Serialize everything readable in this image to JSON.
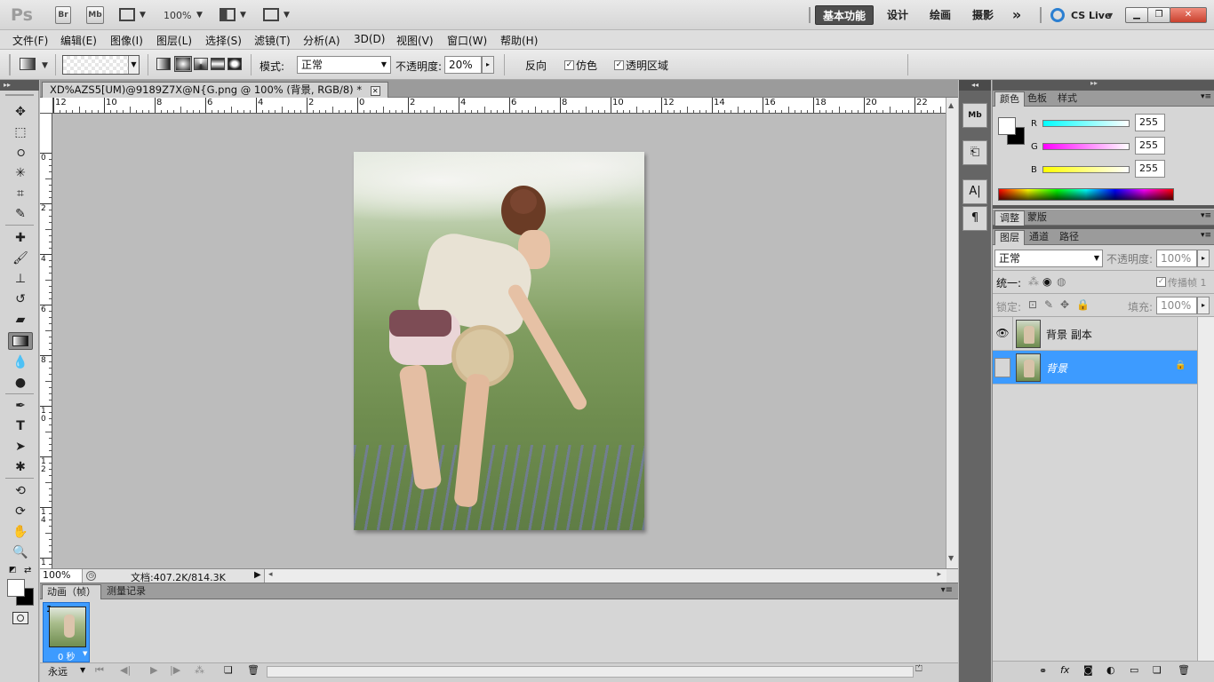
{
  "titlebar": {
    "app_logo": "Ps",
    "bridge_btn": "Br",
    "mini_bridge_btn": "Mb",
    "zoom": "100%",
    "workspaces": [
      "基本功能",
      "设计",
      "绘画",
      "摄影"
    ],
    "more": "»",
    "cs_live": "CS Live",
    "window_controls": [
      "minimize",
      "restore",
      "close"
    ]
  },
  "menu": [
    "文件(F)",
    "编辑(E)",
    "图像(I)",
    "图层(L)",
    "选择(S)",
    "滤镜(T)",
    "分析(A)",
    "3D(D)",
    "视图(V)",
    "窗口(W)",
    "帮助(H)"
  ],
  "options": {
    "mode_label": "模式:",
    "mode_value": "正常",
    "opacity_label": "不透明度:",
    "opacity_value": "20%",
    "reverse_label": "反向",
    "reverse_checked": false,
    "dither_label": "仿色",
    "dither_checked": true,
    "transparency_label": "透明区域",
    "transparency_checked": true
  },
  "document": {
    "tab_title": "XD%AZS5[UM)@9189Z7X@N{G.png @ 100% (背景, RGB/8) *",
    "ruler_h_labels": [
      "12",
      "10",
      "8",
      "6",
      "4",
      "2",
      "0",
      "2",
      "4",
      "6",
      "8",
      "10",
      "12",
      "14",
      "16",
      "18",
      "20",
      "22"
    ],
    "ruler_v_labels": [
      "0",
      "2",
      "4",
      "6",
      "8",
      "1 0",
      "1 2",
      "1 4",
      "1"
    ],
    "status_zoom": "100%",
    "status_doc": "文档:407.2K/814.3K"
  },
  "animation": {
    "tabs": [
      "动画（帧）",
      "测量记录"
    ],
    "frame_number": "1",
    "frame_delay": "0 秒",
    "loop": "永远"
  },
  "color_panel": {
    "tabs": [
      "颜色",
      "色板",
      "样式"
    ],
    "channels": [
      {
        "label": "R",
        "value": "255"
      },
      {
        "label": "G",
        "value": "255"
      },
      {
        "label": "B",
        "value": "255"
      }
    ]
  },
  "adjust_panel": {
    "tabs": [
      "调整",
      "蒙版"
    ]
  },
  "layers_panel": {
    "tabs": [
      "图层",
      "通道",
      "路径"
    ],
    "blend_mode": "正常",
    "opacity_label": "不透明度:",
    "opacity_value": "100%",
    "unify_label": "统一:",
    "propagate_label": "传播帧 1",
    "lock_label": "锁定:",
    "fill_label": "填充:",
    "fill_value": "100%",
    "layers": [
      {
        "name": "背景 副本",
        "visible": true,
        "selected": false
      },
      {
        "name": "背景",
        "visible": false,
        "selected": true
      }
    ]
  },
  "colors": {
    "accent": "#3c98ff",
    "selected_layer": "#3d9bff",
    "panel_bg": "#d6d6d6",
    "canvas_bg": "#bcbcbc"
  }
}
